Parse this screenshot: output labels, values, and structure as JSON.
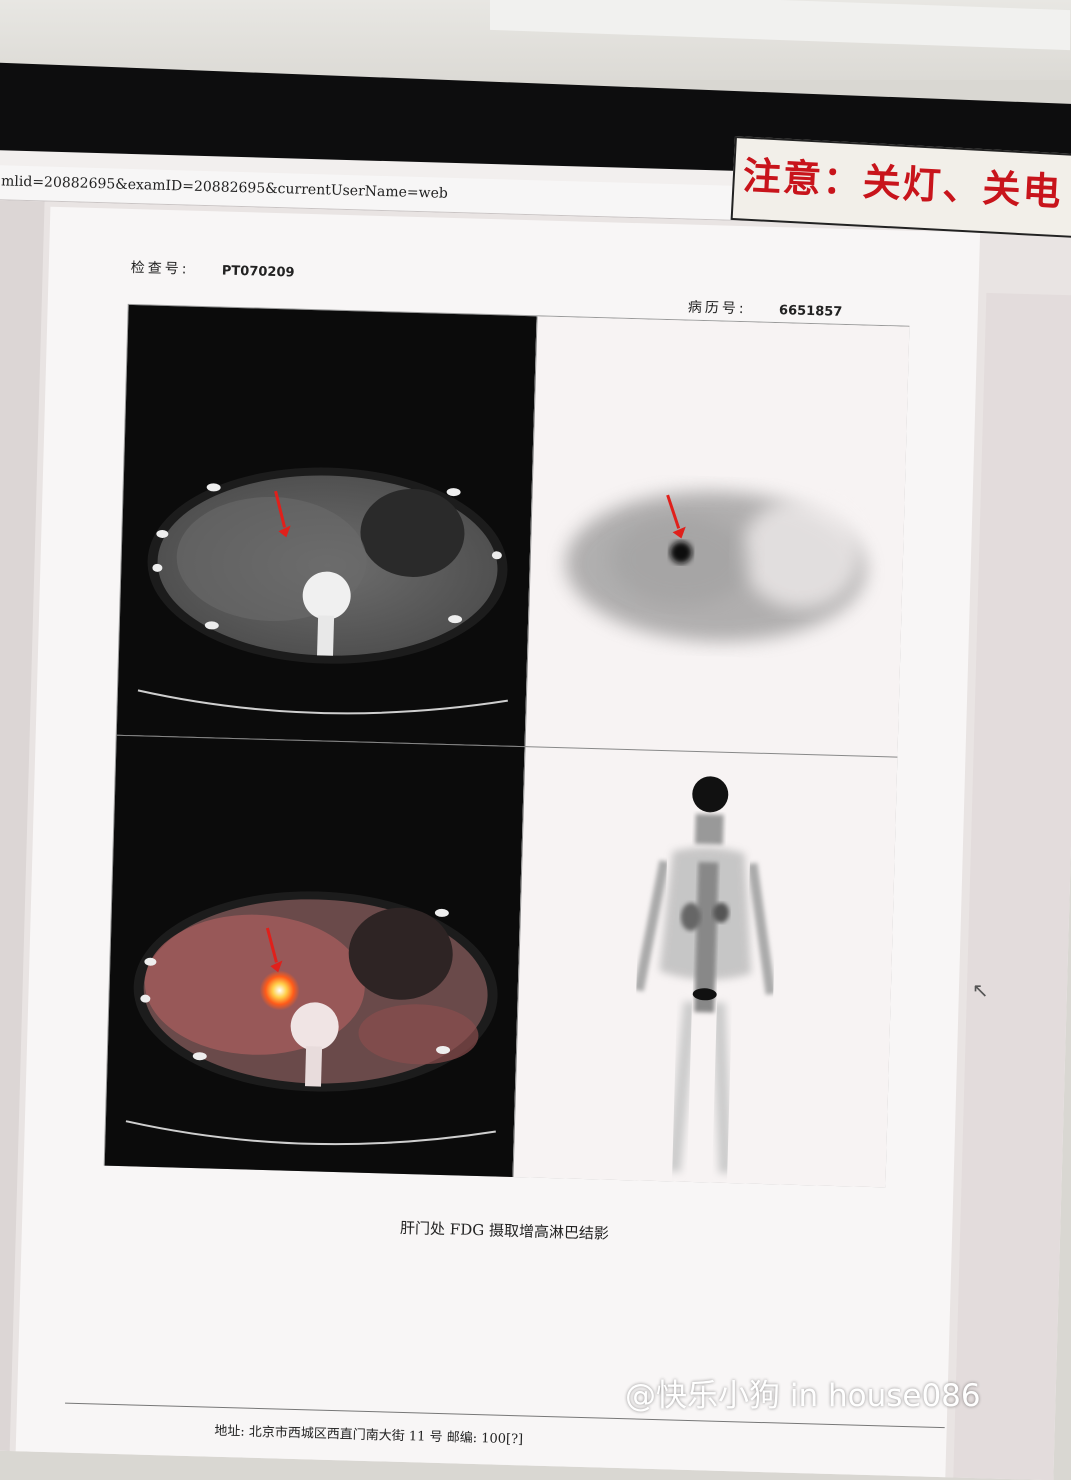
{
  "browser": {
    "url_fragment": "mlid=20882695&examID=20882695&currentUserName=web"
  },
  "notice_sign": {
    "text": "注意：关灯、关电"
  },
  "report": {
    "exam_no_label": "检查号:",
    "exam_no_value": "PT070209",
    "record_no_label": "病历号:",
    "record_no_value": "6651857",
    "caption": "肝门处 FDG 摄取增高淋巴结影",
    "footer_address": "地址: 北京市西城区西直门南大街 11 号  邮编: 100[?]"
  },
  "panels": [
    {
      "name": "ct-axial",
      "arrow": true
    },
    {
      "name": "pet-axial",
      "arrow": true
    },
    {
      "name": "pet-ct-fusion-axial",
      "arrow": true
    },
    {
      "name": "pet-mip-whole-body",
      "arrow": false
    }
  ],
  "colors": {
    "arrow": "#e0201b",
    "notice_text": "#c8141b",
    "fusion_hotspot": "#ffcf4a"
  },
  "watermark": {
    "text": "@快乐小狗 in house086"
  }
}
